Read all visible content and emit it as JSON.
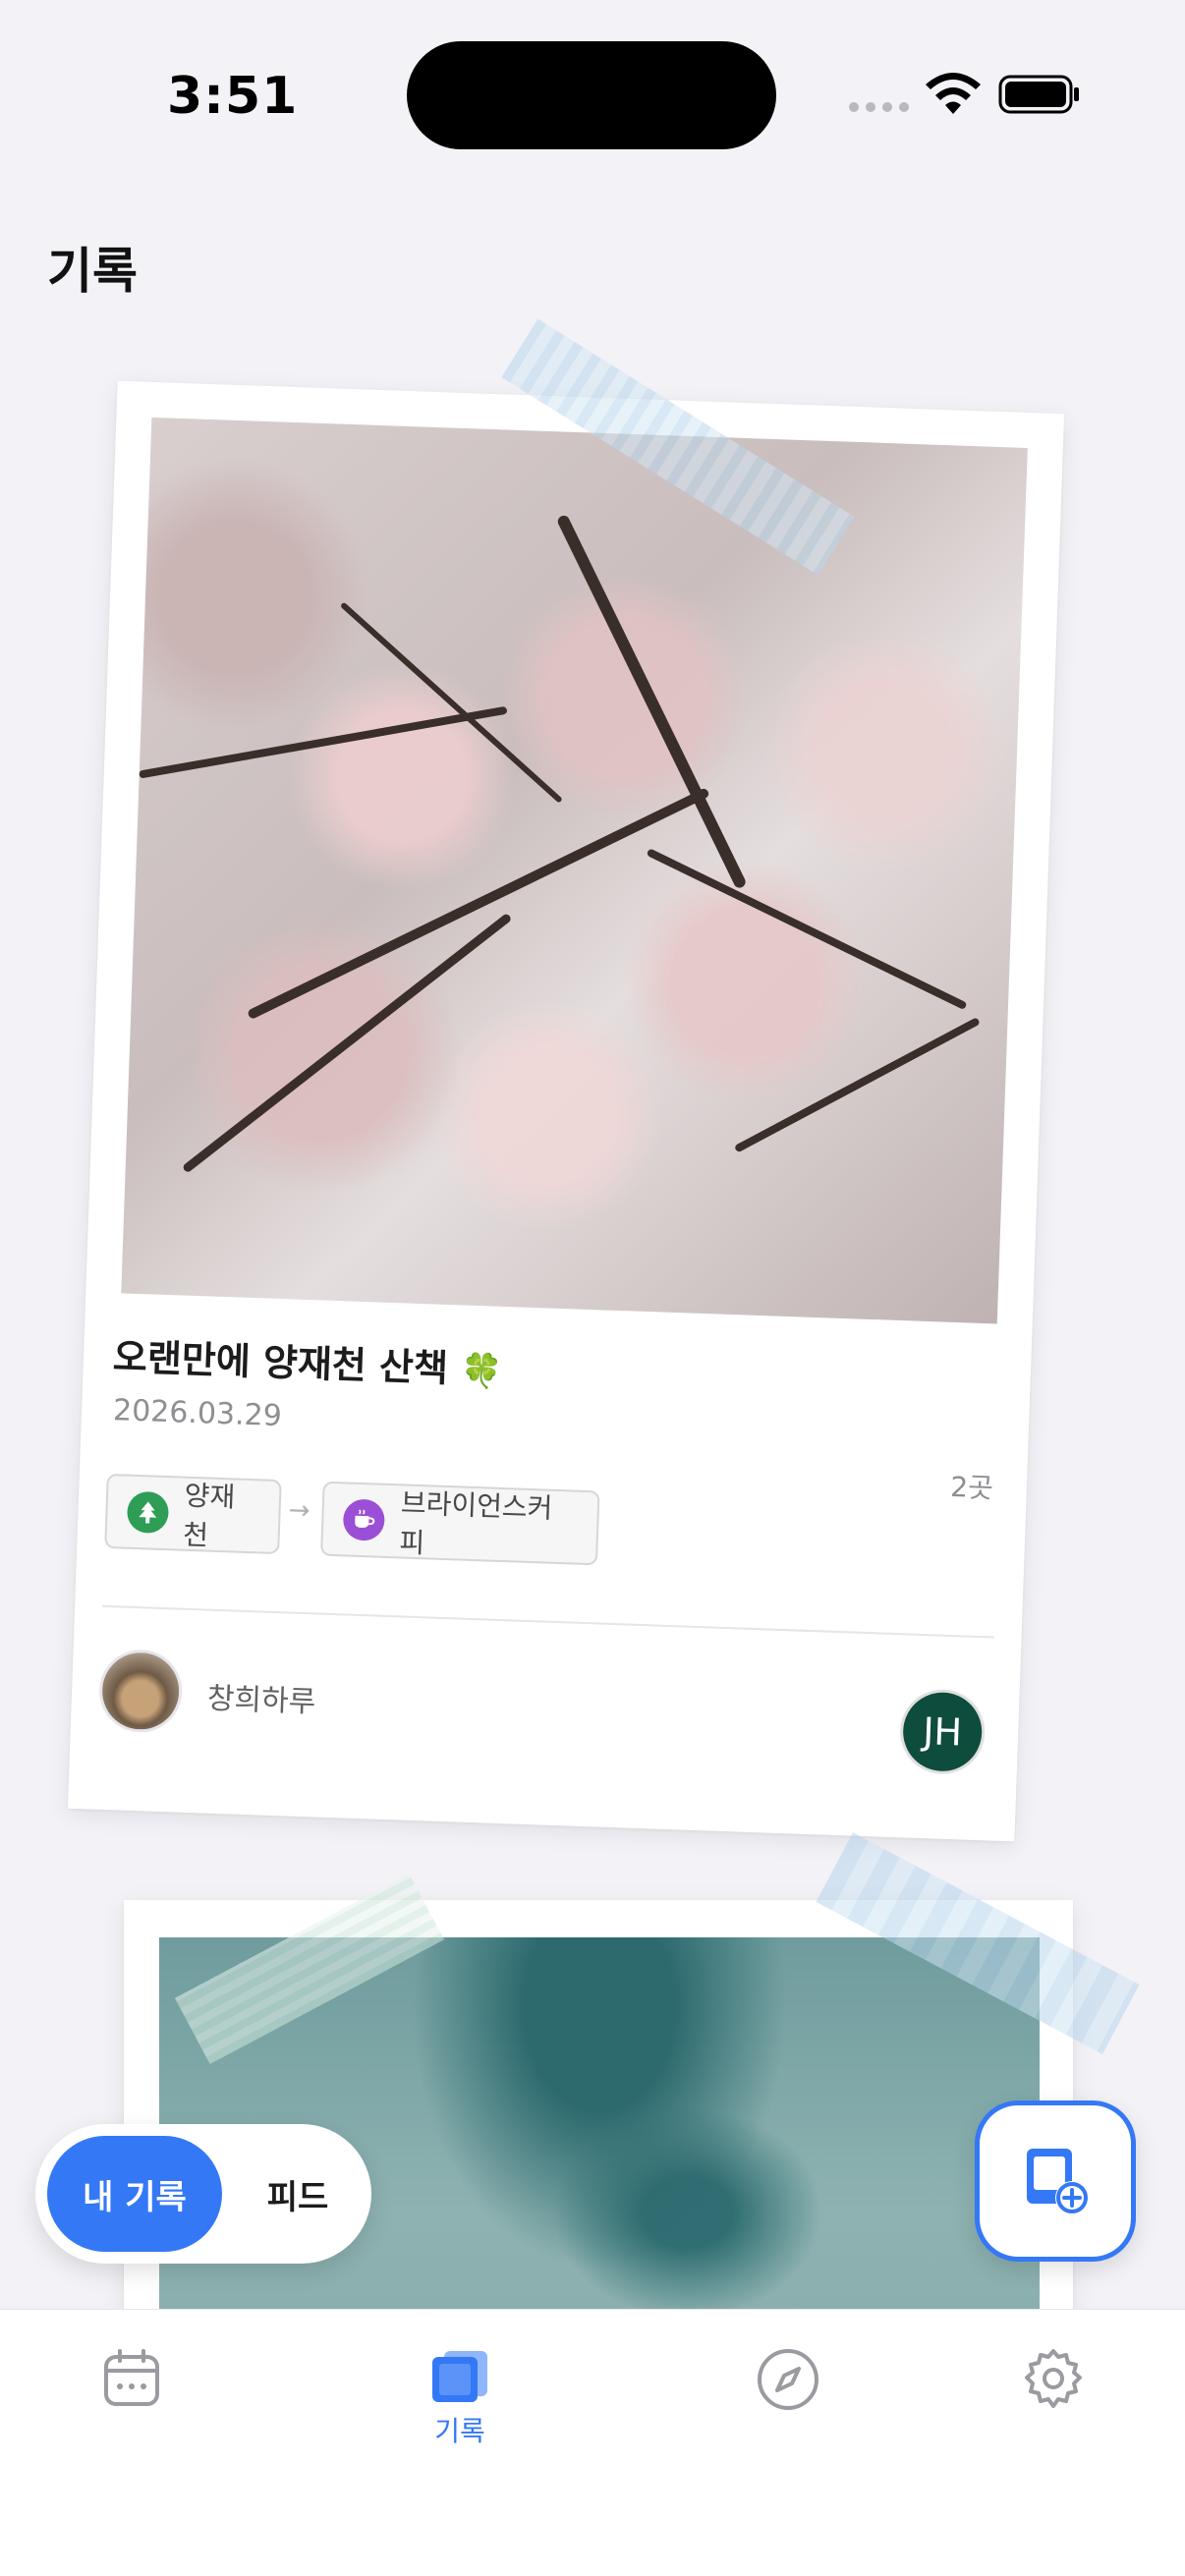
{
  "status_bar": {
    "time": "3:51"
  },
  "header": {
    "title": "기록"
  },
  "records": [
    {
      "title": "오랜만에 양재천 산책",
      "emoji": "🍀",
      "date": "2026.03.29",
      "place_count": "2곳",
      "places": [
        {
          "name": "양재천",
          "icon": "tree-icon",
          "color": "#2e9d55"
        },
        {
          "name": "브라이언스커피",
          "icon": "coffee-icon",
          "color": "#9a4fd6"
        }
      ],
      "author": {
        "name": "창희하루"
      },
      "member": {
        "initials": "JH",
        "color": "#0e4c3e"
      }
    }
  ],
  "segment": {
    "mine": "내 기록",
    "feed": "피드"
  },
  "tabs": [
    {
      "icon": "calendar-icon",
      "label": ""
    },
    {
      "icon": "photos-icon",
      "label": "기록",
      "active": true
    },
    {
      "icon": "compass-icon",
      "label": ""
    },
    {
      "icon": "gear-icon",
      "label": ""
    }
  ],
  "colors": {
    "accent": "#3478f6",
    "background": "#f2f2f7"
  }
}
